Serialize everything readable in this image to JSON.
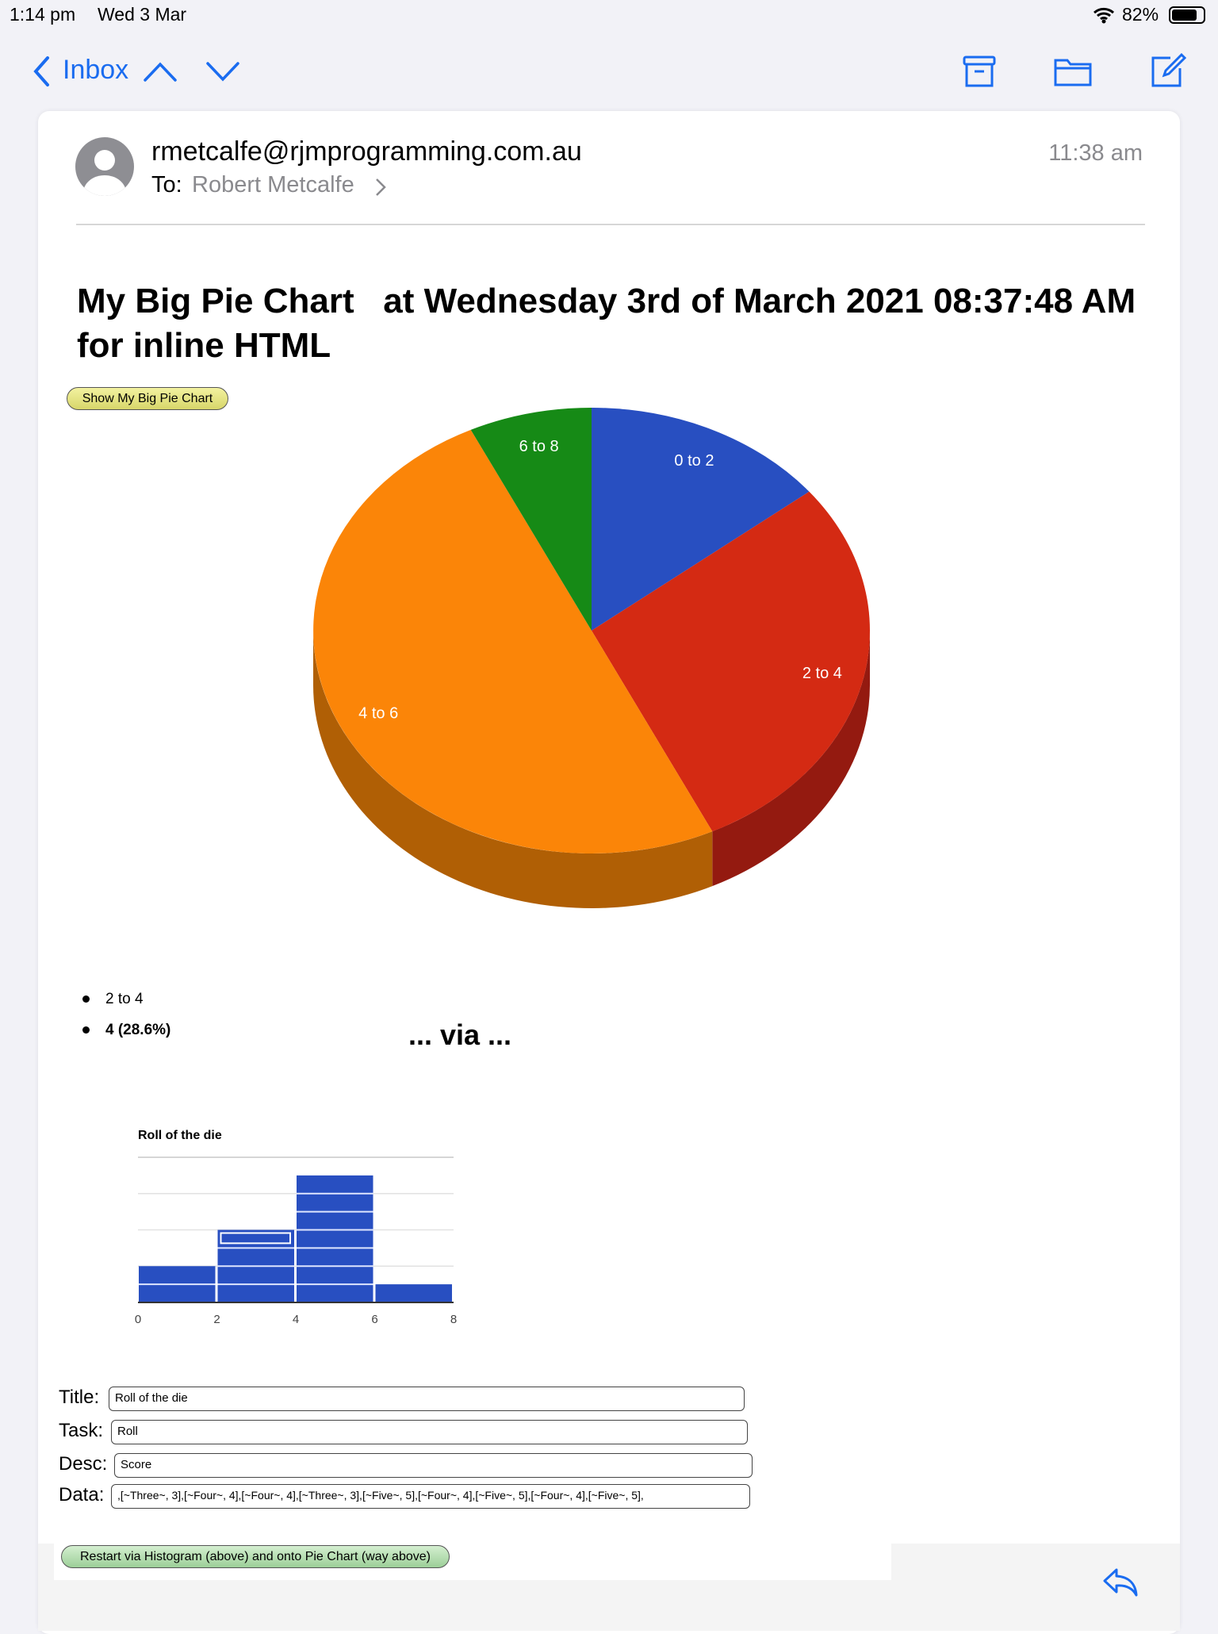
{
  "status_bar": {
    "time": "1:14 pm",
    "date": "Wed 3 Mar",
    "battery": "82%"
  },
  "toolbar": {
    "back_label": "Inbox",
    "icons": [
      "chevron-left-icon",
      "chevron-up-icon",
      "chevron-down-icon",
      "archive-icon",
      "folder-icon",
      "compose-icon",
      "reply-icon"
    ]
  },
  "email": {
    "from": "rmetcalfe@rjmprogramming.com.au",
    "to_label": "To:",
    "to": "Robert Metcalfe",
    "time": "11:38 am",
    "heading": "My Big Pie Chart   at Wednesday 3rd of March 2021 08:37:48 AM\nfor inline HTML",
    "show_button": "Show My Big Pie Chart",
    "legend_items": [
      "2 to 4",
      "4 (28.6%)"
    ],
    "via": "... via ...",
    "form": {
      "title_label": "Title:",
      "title_value": "Roll of the die",
      "task_label": "Task:",
      "task_value": "Roll",
      "desc_label": "Desc:",
      "desc_value": "Score",
      "data_label": "Data:",
      "data_value": ",[~Three~, 3],[~Four~, 4],[~Four~, 4],[~Three~, 3],[~Five~, 5],[~Four~, 4],[~Five~, 5],[~Four~, 4],[~Five~, 5],"
    },
    "restart_button": "Restart via Histogram (above) and onto Pie Chart (way above)"
  },
  "colors": {
    "accent": "#1a6cf0",
    "blue": "#284fc1",
    "red": "#d42a13",
    "orange": "#fb8508",
    "green": "#168a16"
  },
  "chart_data": [
    {
      "type": "pie",
      "style": "3d",
      "categories": [
        "0 to 2",
        "2 to 4",
        "4 to 6",
        "6 to 8"
      ],
      "values": [
        2,
        4,
        7,
        1
      ],
      "colors": [
        "#284fc1",
        "#d42a13",
        "#fb8508",
        "#168a16"
      ],
      "side_colors": [
        "#1c3a8c",
        "#941a10",
        "#b05f05",
        "#0f5e0f"
      ]
    },
    {
      "type": "bar",
      "title": "Roll of the die",
      "categories": [
        "0-2",
        "2-4",
        "4-6",
        "6-8"
      ],
      "values": [
        2,
        4,
        7,
        1
      ],
      "x_ticks": [
        "0",
        "2",
        "4",
        "6",
        "8"
      ],
      "xlim": [
        0,
        8
      ],
      "ylim": [
        0,
        8
      ],
      "grid": true,
      "color": "#284fc1"
    }
  ]
}
